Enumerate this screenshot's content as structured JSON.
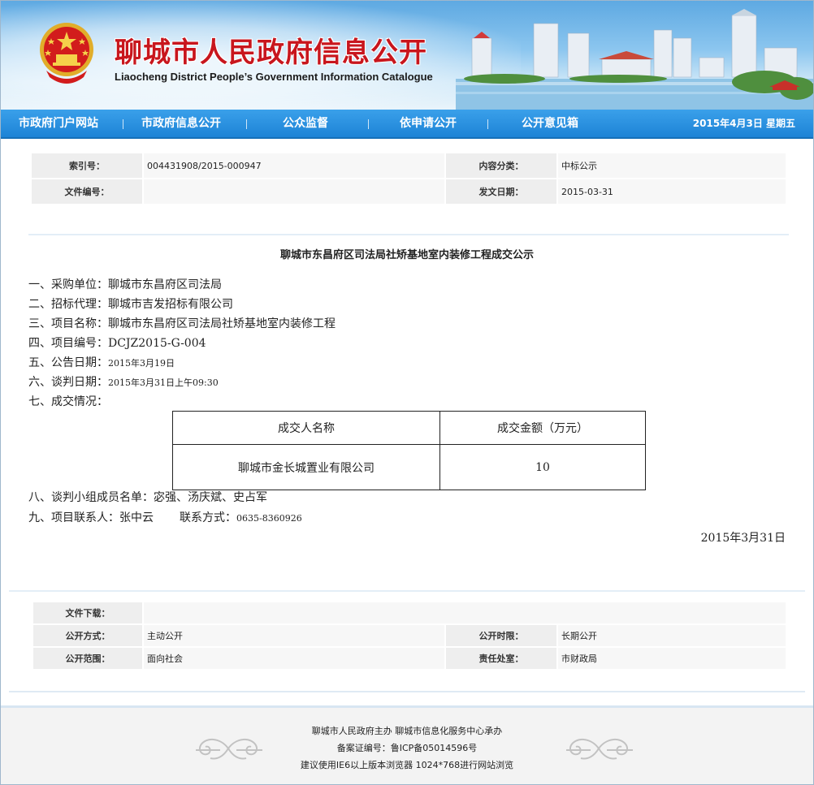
{
  "header": {
    "title": "聊城市人民政府信息公开",
    "subtitle": "Liaocheng District People’s Government  Information Catalogue"
  },
  "nav": {
    "items": [
      {
        "label": "市政府门户网站"
      },
      {
        "label": "市政府信息公开"
      },
      {
        "label": "公众监督"
      },
      {
        "label": "依申请公开"
      },
      {
        "label": "公开意见箱"
      }
    ],
    "date": "2015年4月3日  星期五"
  },
  "meta": {
    "index_label": "索引号：",
    "index_value": "004431908/2015-000947",
    "category_label": "内容分类：",
    "category_value": "中标公示",
    "docno_label": "文件编号：",
    "docno_value": "",
    "issue_label": "发文日期：",
    "issue_value": "2015-03-31"
  },
  "article": {
    "title": "聊城市东昌府区司法局社矫基地室内装修工程成交公示",
    "lines": [
      "一、采购单位：聊城市东昌府区司法局",
      "二、招标代理：聊城市吉发招标有限公司",
      "三、项目名称：聊城市东昌府区司法局社矫基地室内装修工程",
      "四、项目编号：DCJZ2015-G-004"
    ],
    "notice_prefix": "五、公告日期：",
    "notice_date": "2015年3月19日",
    "talk_prefix": "六、谈判日期：",
    "talk_date": "2015年3月31日上午09:30",
    "deal_label": "七、成交情况：",
    "table": {
      "col1": "成交人名称",
      "col2": "成交金额（万元）",
      "winner": "聊城市金长城置业有限公司",
      "amount": "10"
    },
    "members": "八、谈判小组成员名单：宓强、汤庆斌、史占军",
    "contact_prefix": "九、项目联系人：张中云",
    "contact_label": "联系方式：",
    "contact_phone": "0635-8360926",
    "sign_date": "2015年3月31日"
  },
  "bottom_meta": {
    "download_label": "文件下载：",
    "download_value": "",
    "mode_label": "公开方式：",
    "mode_value": "主动公开",
    "time_label": "公开时限：",
    "time_value": "长期公开",
    "scope_label": "公开范围：",
    "scope_value": "面向社会",
    "dept_label": "责任处室：",
    "dept_value": "市财政局"
  },
  "footer": {
    "line1": "聊城市人民政府主办  聊城市信息化服务中心承办",
    "line2": "备案证编号：鲁ICP备05014596号",
    "line3": "建议使用IE6以上版本浏览器  1024*768进行网站浏览"
  },
  "colors": {
    "title_red": "#c8161d",
    "nav_blue": "#1d83d6"
  }
}
